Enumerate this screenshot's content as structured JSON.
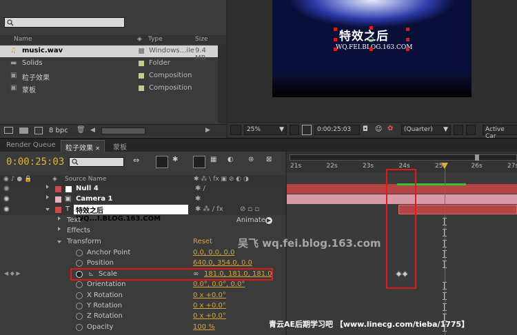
{
  "project": {
    "search_placeholder": "",
    "columns": {
      "name": "Name",
      "type": "Type",
      "size": "Size"
    },
    "items": [
      {
        "name": "music.wav",
        "type": "Windows...ile",
        "size": "9.4 MB",
        "swatch": "#8a8a8a",
        "icon": "audio-file-icon",
        "selected": true
      },
      {
        "name": "Solids",
        "type": "Folder",
        "size": "",
        "swatch": "#c8c890",
        "icon": "folder-icon",
        "selected": false
      },
      {
        "name": "粒子效果",
        "type": "Composition",
        "size": "",
        "swatch": "#c8c890",
        "icon": "composition-icon",
        "selected": false
      },
      {
        "name": "蒙板",
        "type": "Composition",
        "size": "",
        "swatch": "#c8c890",
        "icon": "composition-icon",
        "selected": false
      }
    ],
    "bpc": "8 bpc"
  },
  "viewer": {
    "logo_text": "特效之后",
    "logo_url": "WQ.FEI.BLOG.163.COM",
    "zoom": "25%",
    "timecode": "0:00:25:03",
    "resolution": "(Quarter)",
    "camera": "Active Car"
  },
  "tabs": [
    {
      "label": "Render Queue",
      "active": false
    },
    {
      "label": "粒子效果",
      "active": true
    },
    {
      "label": "蒙板",
      "active": false
    }
  ],
  "timeline": {
    "timecode": "0:00:25:03",
    "source_name_header": "Source Name",
    "layers": [
      {
        "num": "",
        "name": "Null 4",
        "color": "#c84a4a",
        "bar_color": "#b54545",
        "icon": "null-icon"
      },
      {
        "num": "",
        "name": "Camera 1",
        "color": "#e6b3c0",
        "bar_color": "#d99aa8",
        "icon": "camera-icon"
      },
      {
        "num": "",
        "name": "特效之后 WQ...I.BLOG.163.COM",
        "color": "#c84a4a",
        "bar_color": "#b54545",
        "icon": "text-layer-icon"
      }
    ],
    "groups": {
      "text": "Text",
      "effects": "Effects",
      "transform": "Transform",
      "animate": "Animate:",
      "reset": "Reset"
    },
    "properties": [
      {
        "name": "Anchor Point",
        "value": "0.0, 0.0, 0.0"
      },
      {
        "name": "Position",
        "value": "640.0, 354.0, 0.0"
      },
      {
        "name": "Scale",
        "value": "181.0, 181.0, 181.0"
      },
      {
        "name": "Orientation",
        "value": "0.0°, 0.0°, 0.0°"
      },
      {
        "name": "X Rotation",
        "value": "0 x +0.0°"
      },
      {
        "name": "Y Rotation",
        "value": "0 x +0.0°"
      },
      {
        "name": "Z Rotation",
        "value": "0 x +0.0°"
      },
      {
        "name": "Opacity",
        "value": "100 %"
      }
    ],
    "ruler_ticks": [
      "21s",
      "22s",
      "23s",
      "24s",
      "25s",
      "26s",
      "27s"
    ]
  },
  "watermarks": {
    "blog": "吴飞 wq.fei.blog.163.com",
    "forum": "青云AE后期学习吧 【www.linecg.com/tieba/1775】"
  }
}
